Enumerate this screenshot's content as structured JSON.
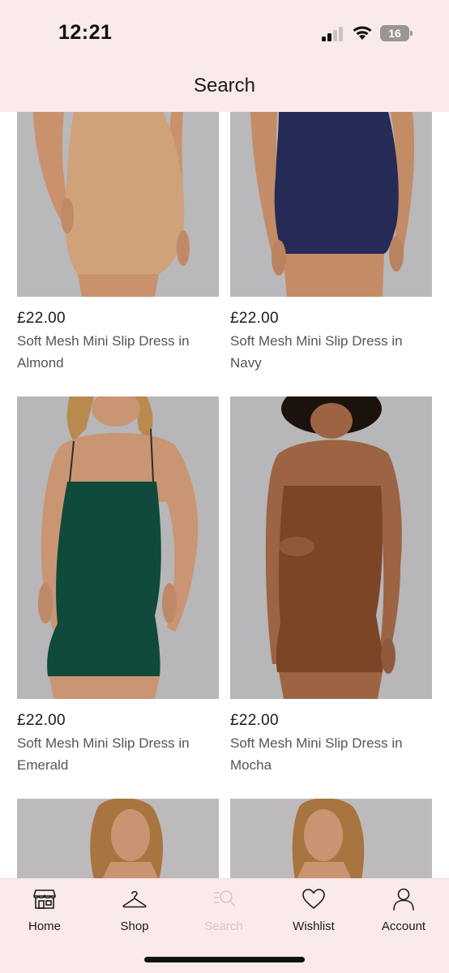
{
  "status_bar": {
    "time": "12:21",
    "battery": "16"
  },
  "header": {
    "title": "Search"
  },
  "products": [
    {
      "price": "£22.00",
      "name": "Soft Mesh Mini Slip Dress in Almond",
      "color": "#cfa27a",
      "skin": "#c9926d",
      "bg": "#b9b8ba"
    },
    {
      "price": "£22.00",
      "name": "Soft Mesh Mini Slip Dress in Navy",
      "color": "#262a57",
      "skin": "#c38c66",
      "bg": "#b9b8ba"
    },
    {
      "price": "£22.00",
      "name": "Soft Mesh Mini Slip Dress in Emerald",
      "color": "#0f4a3c",
      "skin": "#c99572",
      "bg": "#b7b6b8"
    },
    {
      "price": "£22.00",
      "name": "Soft Mesh Mini Slip Dress in Mocha",
      "color": "#7b4526",
      "skin": "#9c6443",
      "bg": "#b7b6b8"
    },
    {
      "price": "",
      "name": "",
      "color": "#2b1b14",
      "skin": "#c99472",
      "bg": "#bcbabb"
    },
    {
      "price": "",
      "name": "",
      "color": "#2b1b14",
      "skin": "#c99472",
      "bg": "#bcbabb"
    }
  ],
  "tabbar": {
    "items": [
      {
        "label": "Home",
        "icon": "store-icon",
        "active": false
      },
      {
        "label": "Shop",
        "icon": "hanger-icon",
        "active": false
      },
      {
        "label": "Search",
        "icon": "search-list-icon",
        "active": true
      },
      {
        "label": "Wishlist",
        "icon": "heart-icon",
        "active": false
      },
      {
        "label": "Account",
        "icon": "person-icon",
        "active": false
      }
    ],
    "active_color": "#d7c6c6",
    "background": "#fbeaea"
  }
}
